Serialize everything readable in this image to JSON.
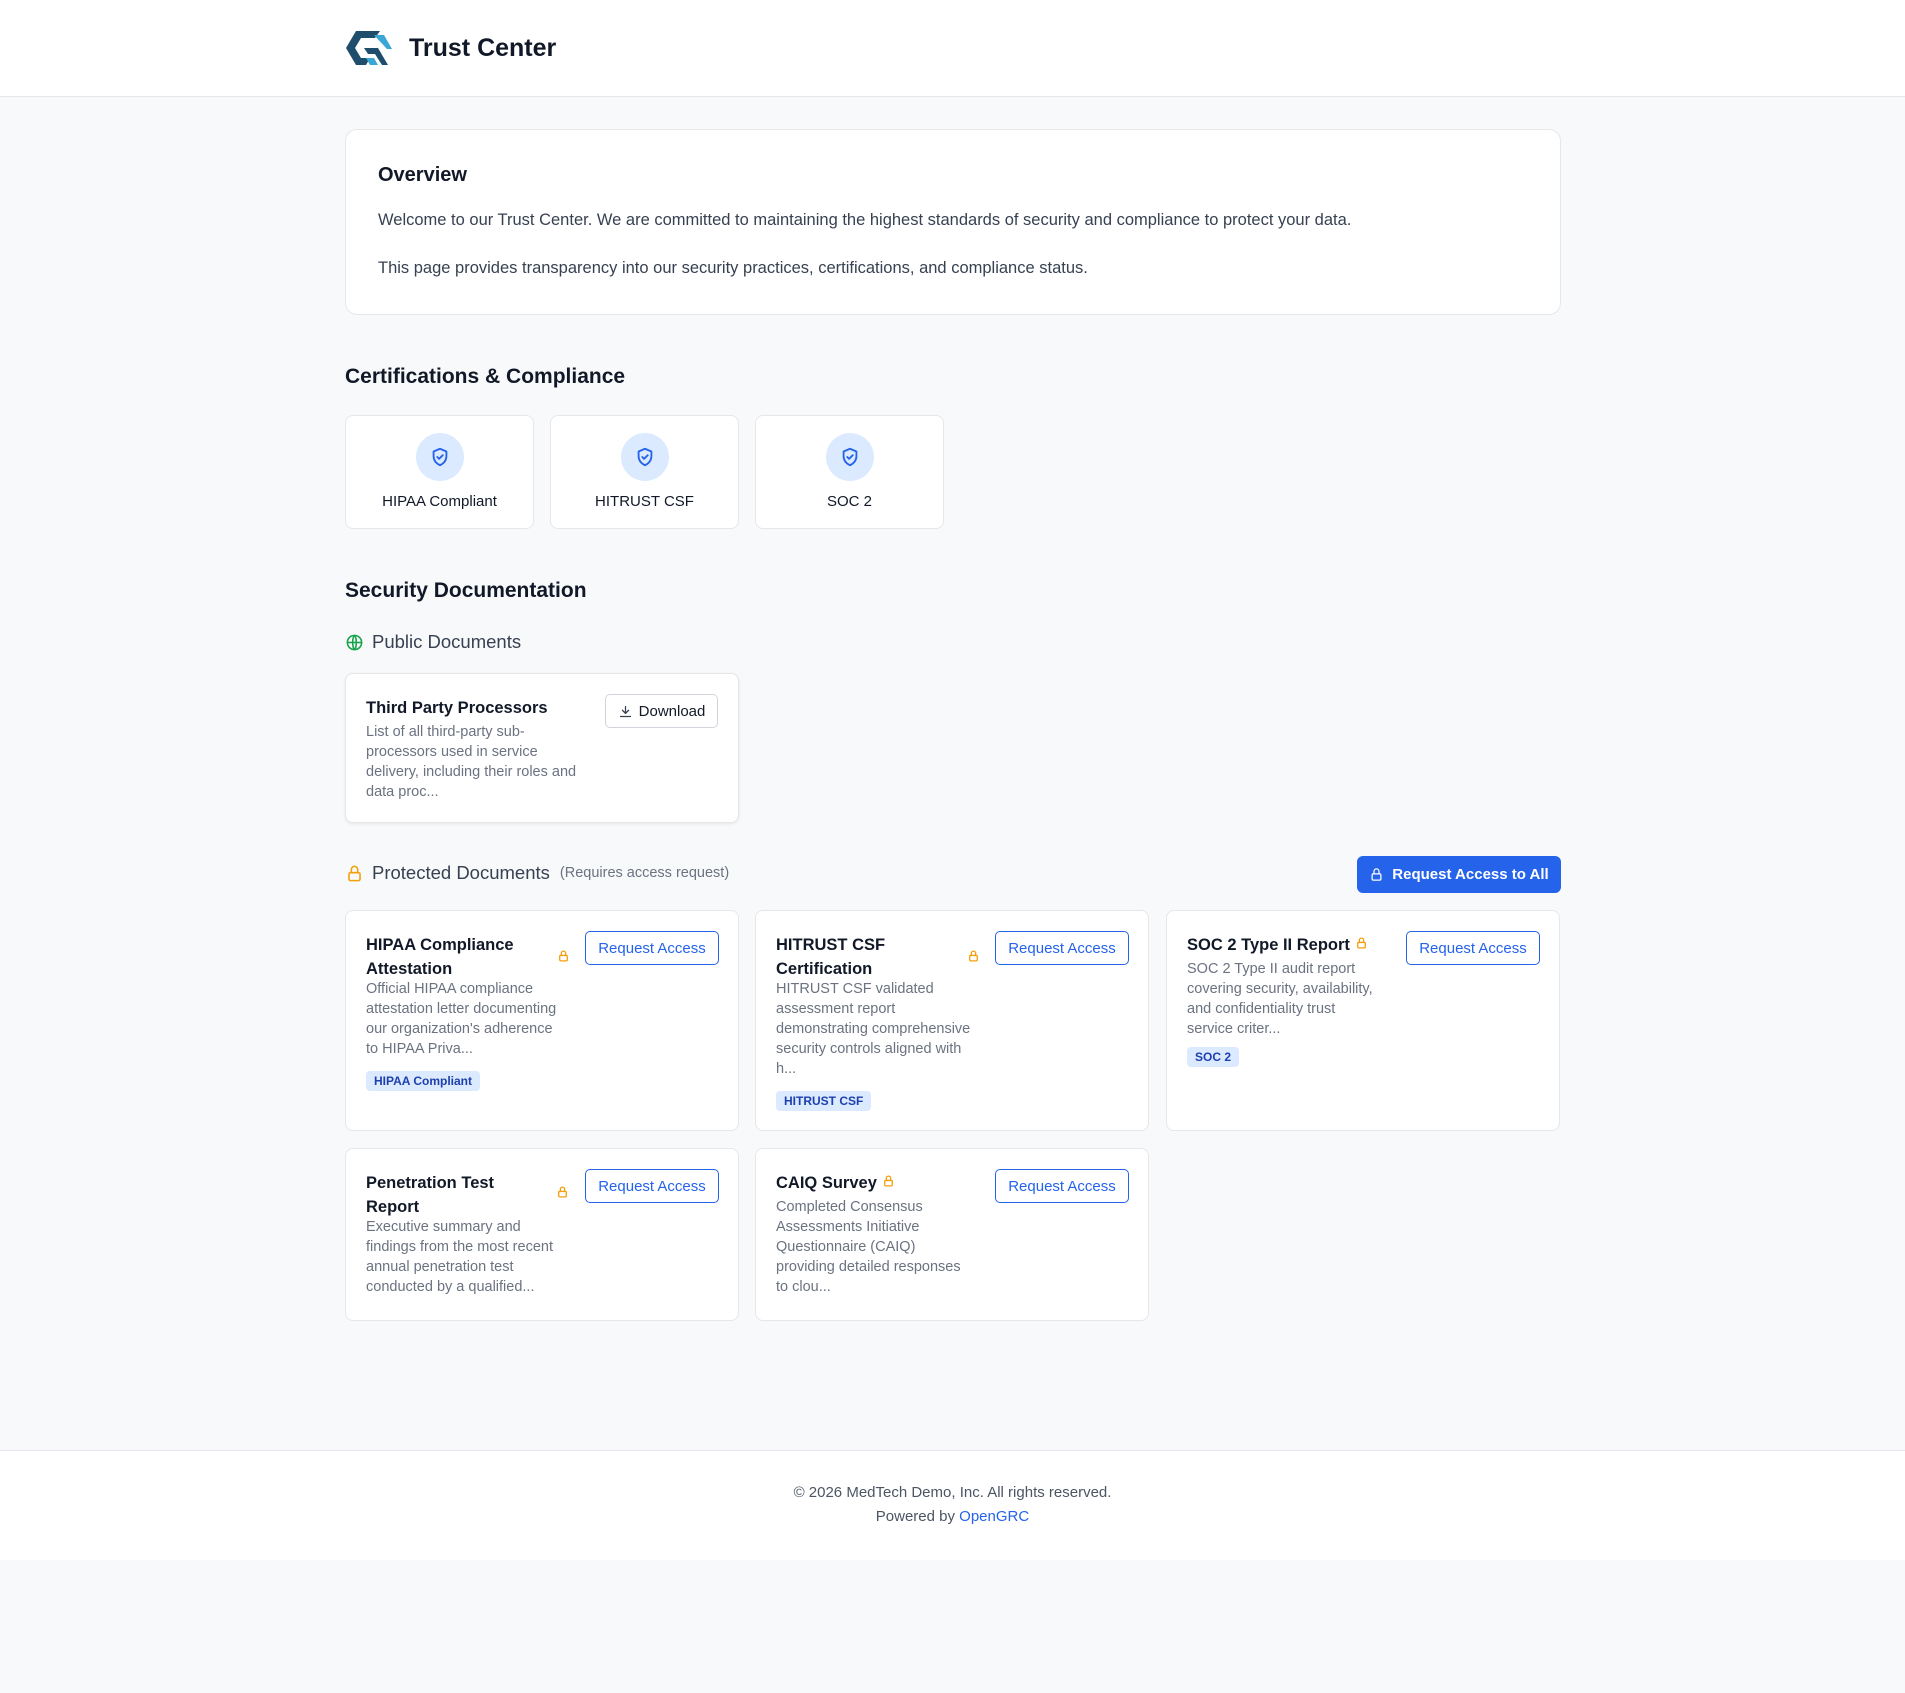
{
  "header": {
    "title": "Trust Center"
  },
  "overview": {
    "heading": "Overview",
    "para1": "Welcome to our Trust Center. We are committed to maintaining the highest standards of security and compliance to protect your data.",
    "para2": "This page provides transparency into our security practices, certifications, and compliance status."
  },
  "certifications": {
    "heading": "Certifications & Compliance",
    "items": [
      {
        "label": "HIPAA Compliant"
      },
      {
        "label": "HITRUST CSF"
      },
      {
        "label": "SOC 2"
      }
    ]
  },
  "security_docs": {
    "heading": "Security Documentation",
    "public": {
      "heading": "Public Documents",
      "docs": [
        {
          "title": "Third Party Processors",
          "desc_lines": [
            "List of all third-party sub-",
            "processors used in service",
            "delivery, including their roles and",
            "data proc..."
          ],
          "button": "Download"
        }
      ]
    },
    "protected": {
      "heading": "Protected Documents",
      "hint": "(Requires access request)",
      "request_all": "Request Access to All",
      "request_label": "Request Access",
      "docs": [
        {
          "title_lines": [
            "HIPAA Compliance",
            "Attestation"
          ],
          "desc_lines": [
            "Official HIPAA compliance",
            "attestation letter documenting",
            "our organization's adherence",
            "to HIPAA Priva..."
          ],
          "tag": "HIPAA Compliant"
        },
        {
          "title_lines": [
            "HITRUST CSF",
            "Certification"
          ],
          "desc_lines": [
            "HITRUST CSF validated",
            "assessment report",
            "demonstrating comprehensive",
            "security controls aligned with",
            "h..."
          ],
          "tag": "HITRUST CSF"
        },
        {
          "title_lines": [
            "SOC 2 Type II Report"
          ],
          "desc_lines": [
            "SOC 2 Type II audit report",
            "covering security, availability,",
            "and confidentiality trust",
            "service criter..."
          ],
          "tag": "SOC 2"
        },
        {
          "title_lines": [
            "Penetration Test",
            "Report"
          ],
          "desc_lines": [
            "Executive summary and",
            "findings from the most recent",
            "annual penetration test",
            "conducted by a qualified..."
          ]
        },
        {
          "title_lines": [
            "CAIQ Survey"
          ],
          "desc_lines": [
            "Completed Consensus",
            "Assessments Initiative",
            "Questionnaire (CAIQ)",
            "providing detailed responses",
            "to clou..."
          ]
        }
      ]
    }
  },
  "footer": {
    "copyright": "© 2026 MedTech Demo, Inc. All rights reserved.",
    "powered_prefix": "Powered by",
    "powered_link": "OpenGRC"
  },
  "colors": {
    "accent": "#2563eb",
    "lock": "#f59e0b",
    "globe": "#16a34a",
    "tag_bg": "#dbeafe"
  },
  "icons": [
    "logo-icon",
    "shield-check-icon",
    "globe-icon",
    "lock-icon",
    "download-icon"
  ]
}
